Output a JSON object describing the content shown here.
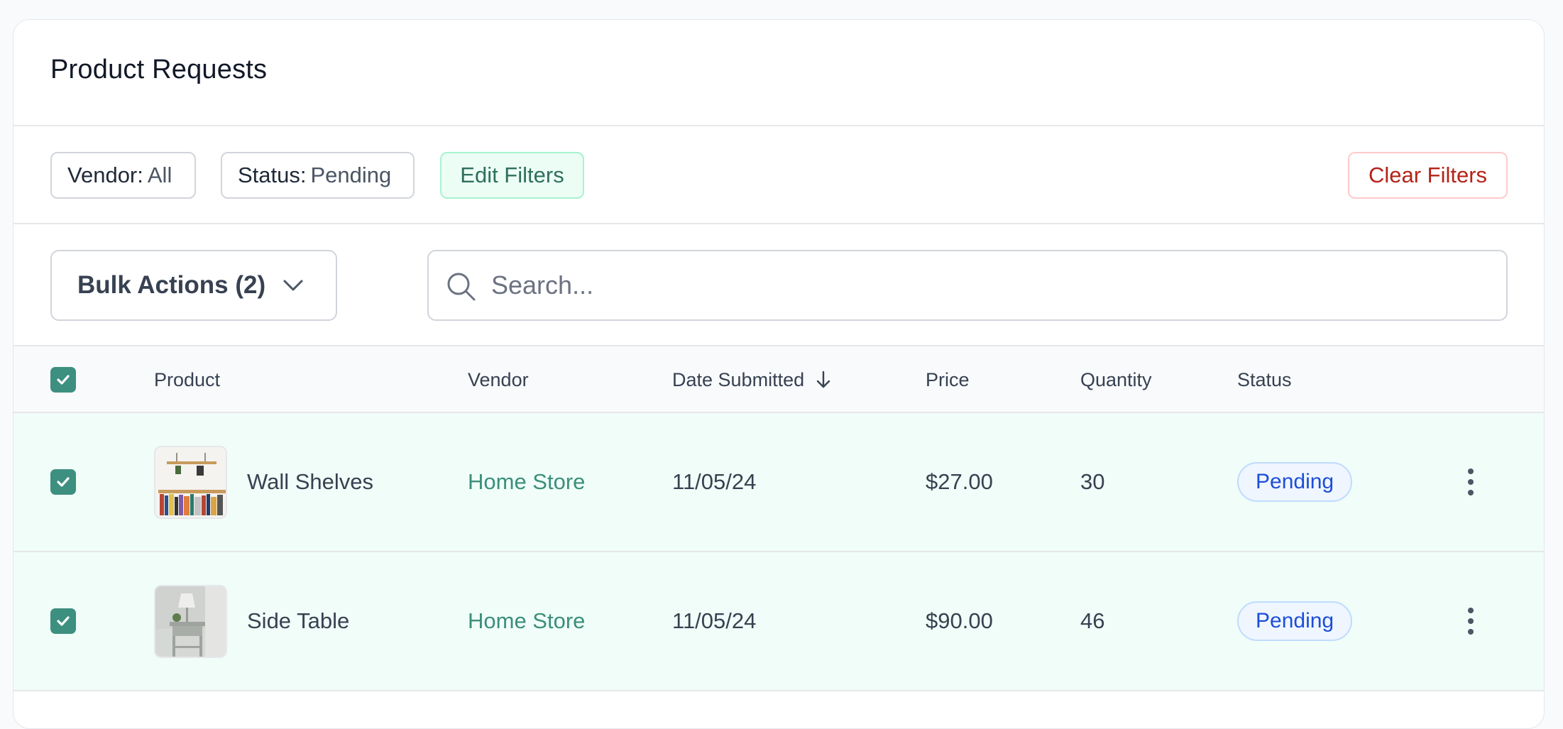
{
  "page": {
    "title": "Product Requests"
  },
  "filters": {
    "vendor": {
      "key": "Vendor:",
      "value": "All"
    },
    "status": {
      "key": "Status:",
      "value": "Pending"
    },
    "edit_label": "Edit Filters",
    "clear_label": "Clear Filters"
  },
  "toolbar": {
    "bulk_label": "Bulk Actions (2)",
    "search_placeholder": "Search..."
  },
  "table": {
    "columns": {
      "product": "Product",
      "vendor": "Vendor",
      "date": "Date Submitted",
      "price": "Price",
      "quantity": "Quantity",
      "status": "Status"
    },
    "sort_icon": "arrow-down-icon",
    "rows": [
      {
        "product": "Wall Shelves",
        "vendor": "Home Store",
        "date": "11/05/24",
        "price": "$27.00",
        "quantity": "30",
        "status": "Pending",
        "selected": true
      },
      {
        "product": "Side Table",
        "vendor": "Home Store",
        "date": "11/05/24",
        "price": "$90.00",
        "quantity": "46",
        "status": "Pending",
        "selected": true
      }
    ]
  },
  "colors": {
    "accent": "#3d8f7f",
    "selected_row": "#f0fdf8",
    "pending_text": "#1d4ed8",
    "danger": "#b42318"
  }
}
